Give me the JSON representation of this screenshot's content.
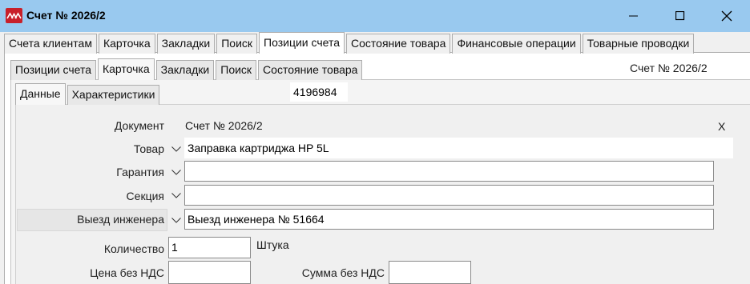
{
  "window": {
    "title": "Счет № 2026/2",
    "icon": "app-logo-icon",
    "controls": [
      "minimize-icon",
      "maximize-icon",
      "close-icon"
    ]
  },
  "tabs_main": [
    "Счета клиентам",
    "Карточка",
    "Закладки",
    "Поиск",
    "Позиции счета",
    "Состояние товара",
    "Финансовые операции",
    "Товарные проводки"
  ],
  "tabs_main_active": "Позиции счета",
  "tabs_sub": [
    "Позиции счета",
    "Карточка",
    "Закладки",
    "Поиск",
    "Состояние товара"
  ],
  "tabs_sub_active": "Карточка",
  "tabs_card": [
    "Данные",
    "Характеристики"
  ],
  "tabs_card_active": "Данные",
  "header": {
    "invoice_ref": "Счет № 2026/2",
    "record_id": "4196984"
  },
  "form": {
    "document_label": "Документ",
    "document_value": "Счет № 2026/2",
    "close_mark": "X",
    "product_label": "Товар",
    "product_value": "Заправка картриджа HP 5L",
    "warranty_label": "Гарантия",
    "warranty_value": "",
    "section_label": "Секция",
    "section_value": "",
    "engineer_label": "Выезд инженера",
    "engineer_value": "Выезд инженера № 51664",
    "quantity_label": "Количество",
    "quantity_value": "1",
    "unit": "Штука",
    "price_label": "Цена без НДС",
    "price_value": "",
    "sum_label": "Сумма без НДС",
    "sum_value": ""
  }
}
